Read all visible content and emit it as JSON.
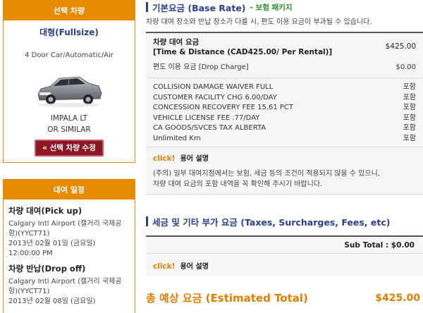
{
  "vehicle": {
    "header": "선택 차량",
    "class": "대형(Fullsize)",
    "spec": "4 Door Car/Automatic/Air",
    "name_line1": "IMPALA LT",
    "name_line2": "OR SIMILAR",
    "modify_button": "« 선택 차량 수정"
  },
  "rental": {
    "header": "대여 일정",
    "pickup": {
      "title": "차량 대여(Pick up)",
      "location_line1": "Calgary Intl Airport (캘거리 국제공",
      "location_line2": "항)(YYCT71)",
      "date": "2013년 02월 01일 (금요일)",
      "time": "12:00:00 PM"
    },
    "dropoff": {
      "title": "차량 반납(Drop off)",
      "location_line1": "Calgary Intl Airport (캘거리 국제공",
      "location_line2": "항)(YYCT71)",
      "date": "2013년 02월 08일 (금요일)"
    }
  },
  "base_rate": {
    "title": "기본요금 (Base Rate)",
    "subtitle": "- 보험 패키지",
    "description": "차량 대여 장소와 반납 장소가 다를 시, 편도 이용 요금이 부과될 수 있습니다.",
    "main_label_line1": "차량 대여 요금",
    "main_label_line2": "[Time & Distance (CAD425.00/ Per Rental)]",
    "main_value": "$425.00",
    "drop_label": "편도 이용 요금 [Drop Charge]",
    "drop_value": "$0.00",
    "fees": [
      {
        "name": "COLLISION DAMAGE WAIVER FULL",
        "status": "포함"
      },
      {
        "name": "CUSTOMER FACILITY CHG 6.00/DAY",
        "status": "포함"
      },
      {
        "name": "CONCESSION RECOVERY FEE 15.61 PCT",
        "status": "포함"
      },
      {
        "name": "VEHICLE LICENSE FEE .77/DAY",
        "status": "포함"
      },
      {
        "name": "CA GOODS/SVCES TAX ALBERTA",
        "status": "포함"
      },
      {
        "name": "Unlimited Km",
        "status": "포함"
      }
    ],
    "click_text": "click!",
    "click_label": "용어 설명",
    "note_line1": "(주의) 일부 대여지점에서는 보험, 세금 등의 조건이 적용되지 않을 수 있으니,",
    "note_line2": "차량 대여 요금의 포함 내역을 꼭 확인해 주시기 바랍니다."
  },
  "taxes": {
    "title": "세금 및 기타 부가 요금 (Taxes, Surcharges, Fees, etc)",
    "subtotal": "Sub Total : $0.00",
    "click_text": "click!",
    "click_label": "용어 설명"
  },
  "total": {
    "label": "총 예상 요금 (Estimated Total)",
    "value": "$425.00"
  },
  "colors": {
    "accent_orange": "#e88a00",
    "brand_navy": "#2a3f8f",
    "button_red": "#8e1622",
    "highlight_green": "#2e8b2e"
  }
}
